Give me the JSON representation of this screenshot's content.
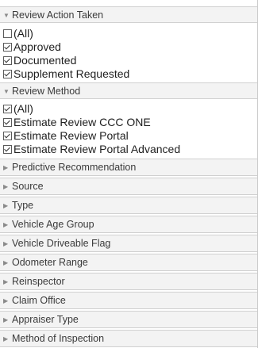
{
  "sections": {
    "review_action": {
      "title": "Review Action Taken",
      "options": [
        {
          "label": "(All)",
          "checked": false
        },
        {
          "label": "Approved",
          "checked": true
        },
        {
          "label": "Documented",
          "checked": true
        },
        {
          "label": "Supplement Requested",
          "checked": true
        }
      ]
    },
    "review_method": {
      "title": "Review Method",
      "options": [
        {
          "label": "(All)",
          "checked": true
        },
        {
          "label": "Estimate Review CCC ONE",
          "checked": true
        },
        {
          "label": "Estimate Review Portal",
          "checked": true
        },
        {
          "label": "Estimate Review Portal Advanced",
          "checked": true
        }
      ]
    },
    "collapsed": [
      "Predictive Recommendation",
      "Source",
      "Type",
      "Vehicle Age Group",
      "Vehicle Driveable Flag",
      "Odometer Range",
      "Reinspector",
      "Claim Office",
      "Appraiser Type",
      "Method of Inspection"
    ]
  },
  "icons": {
    "expanded": "triangle-down-icon",
    "collapsed": "triangle-right-icon"
  }
}
